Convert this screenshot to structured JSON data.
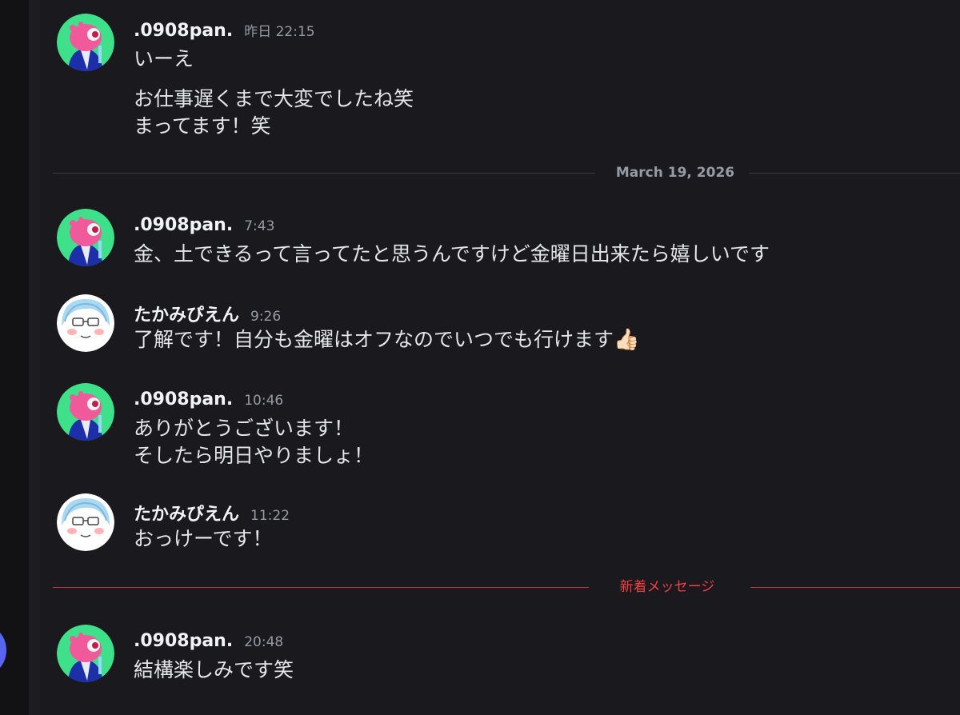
{
  "colors": {
    "background": "#1a1a1e",
    "author": "#f2f3f5",
    "timestamp": "#949ba4",
    "new_messages": "#f23f43",
    "mention_blurple": "#5865f2"
  },
  "users": {
    "pan": {
      "name": ".0908pan.",
      "avatar_icon": "pink-fish-avatar-icon"
    },
    "takami": {
      "name": "たかみぴえん",
      "avatar_icon": "blue-hair-boy-avatar-icon"
    }
  },
  "messages": [
    {
      "author": ".0908pan.",
      "time": "昨日 22:15",
      "lines": [
        "いーえ",
        "お仕事遅くまで大変でしたね笑",
        "まってます！笑"
      ]
    },
    {
      "author": ".0908pan.",
      "time": "7:43",
      "lines": [
        "金、土できるって言ってたと思うんですけど金曜日出来たら嬉しいです"
      ]
    },
    {
      "author": "たかみぴえん",
      "time": "9:26",
      "lines": [
        "了解です！自分も金曜はオフなのでいつでも行けます"
      ],
      "emoji": "👍🏻"
    },
    {
      "author": ".0908pan.",
      "time": "10:46",
      "lines": [
        "ありがとうございます！",
        "そしたら明日やりましょ！"
      ]
    },
    {
      "author": "たかみぴえん",
      "time": "11:22",
      "lines": [
        "おっけーです！"
      ]
    },
    {
      "author": ".0908pan.",
      "time": "20:48",
      "lines": [
        "結構楽しみです笑"
      ]
    }
  ],
  "dividers": {
    "date": "March 19, 2026",
    "new_messages": "新着メッセージ"
  }
}
